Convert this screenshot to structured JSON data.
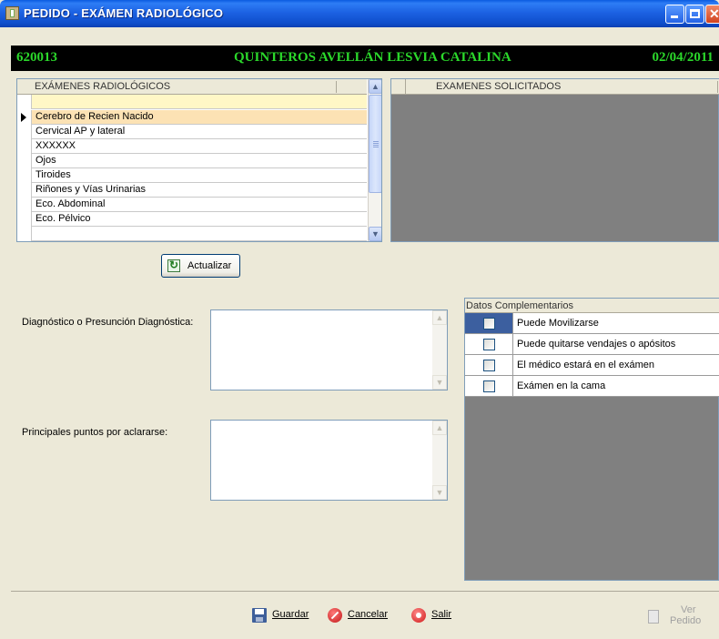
{
  "window": {
    "title": "PEDIDO - EXÁMEN RADIOLÓGICO"
  },
  "patient": {
    "id": "620013",
    "name": "QUINTEROS AVELLÁN LESVIA CATALINA",
    "date": "02/04/2011"
  },
  "exams_list": {
    "header": "EXÁMENES RADIOLÓGICOS",
    "new_row_value": "",
    "selected_index": 0,
    "items": [
      "Cerebro de Recien Nacido",
      "Cervical AP y lateral",
      "XXXXXX",
      "Ojos",
      "Tiroides",
      "Riñones y Vías Urinarias",
      "Eco. Abdominal",
      "Eco. Pélvico"
    ]
  },
  "requested": {
    "header": "EXAMENES SOLICITADOS"
  },
  "actions": {
    "refresh_label": "Actualizar"
  },
  "form": {
    "diagnosis_label": "Diagnóstico o Presunción Diagnóstica:",
    "diagnosis_value": "",
    "points_label": "Principales puntos por aclararse:",
    "points_value": ""
  },
  "datos": {
    "header": "Datos Complementarios",
    "items": [
      {
        "label": "Puede Movilizarse",
        "checked": false
      },
      {
        "label": "Puede quitarse vendajes o apósitos",
        "checked": false
      },
      {
        "label": "El médico estará en el exámen",
        "checked": false
      },
      {
        "label": "Exámen en la cama",
        "checked": false
      }
    ]
  },
  "toolbar": {
    "save_label": "Guardar",
    "cancel_label": "Cancelar",
    "exit_label": "Salir",
    "ver_line1": "Ver",
    "ver_line2": "Pedido"
  },
  "colors": {
    "titlebar": "#0A5BE0",
    "info_bg": "#000000",
    "info_text": "#2BD82B",
    "selected_row": "#FCE2B4",
    "new_row": "#FFF7C6",
    "panel_gray": "#808080"
  },
  "icons": {
    "app": "app-icon",
    "refresh": "refresh-icon",
    "save": "save-disk-icon",
    "cancel": "cancel-icon",
    "exit": "exit-icon",
    "ver": "document-icon"
  }
}
